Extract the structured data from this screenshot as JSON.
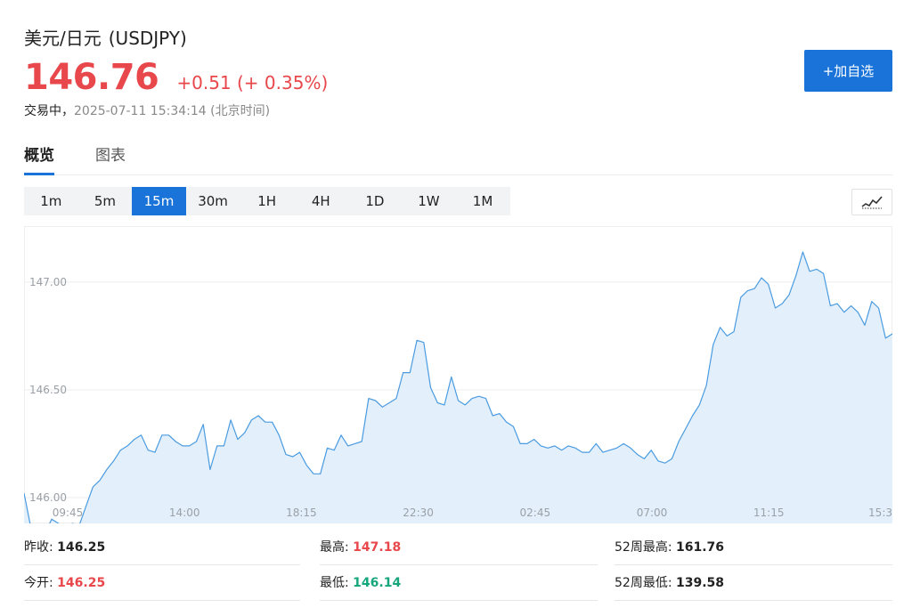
{
  "header": {
    "name": "美元/日元",
    "symbol": "(USDJPY)",
    "price": "146.76",
    "change": "+0.51 (+ 0.35%)",
    "status": "交易中，",
    "timestamp": "2025-07-11 15:34:14 (北京时间)",
    "watch_button": "+加自选"
  },
  "tabs": [
    {
      "label": "概览",
      "active": true
    },
    {
      "label": "图表",
      "active": false
    }
  ],
  "periods": [
    {
      "label": "1m",
      "active": false
    },
    {
      "label": "5m",
      "active": false
    },
    {
      "label": "15m",
      "active": true
    },
    {
      "label": "30m",
      "active": false
    },
    {
      "label": "1H",
      "active": false
    },
    {
      "label": "4H",
      "active": false
    },
    {
      "label": "1D",
      "active": false
    },
    {
      "label": "1W",
      "active": false
    },
    {
      "label": "1M",
      "active": false
    }
  ],
  "chart_type_icon": "line-chart-icon",
  "colors": {
    "accent": "#1a73d9",
    "up": "#e8474b",
    "down": "#16a67c",
    "line": "#4a9be0",
    "fill": "#e3f0fc"
  },
  "chart_data": {
    "type": "area",
    "title": "",
    "xlabel": "",
    "ylabel": "",
    "ylim": [
      145.88,
      147.26
    ],
    "yticks": [
      "146.00",
      "146.50",
      "147.00"
    ],
    "xticks": [
      "09:45",
      "14:00",
      "18:15",
      "22:30",
      "02:45",
      "07:00",
      "11:15",
      "15:3"
    ],
    "grid": true,
    "series": [
      {
        "values": [
          146.02,
          145.86,
          145.86,
          145.83,
          145.9,
          145.88,
          145.8,
          145.88,
          145.87,
          145.96,
          146.05,
          146.08,
          146.13,
          146.17,
          146.22,
          146.24,
          146.27,
          146.29,
          146.22,
          146.21,
          146.29,
          146.29,
          146.26,
          146.24,
          146.24,
          146.26,
          146.34,
          146.13,
          146.24,
          146.24,
          146.36,
          146.27,
          146.3,
          146.36,
          146.38,
          146.35,
          146.35,
          146.29,
          146.2,
          146.19,
          146.21,
          146.15,
          146.11,
          146.11,
          146.23,
          146.22,
          146.29,
          146.24,
          146.25,
          146.26,
          146.46,
          146.45,
          146.42,
          146.44,
          146.46,
          146.58,
          146.58,
          146.73,
          146.72,
          146.51,
          146.44,
          146.43,
          146.56,
          146.45,
          146.43,
          146.46,
          146.47,
          146.46,
          146.38,
          146.39,
          146.35,
          146.33,
          146.25,
          146.25,
          146.27,
          146.24,
          146.23,
          146.24,
          146.22,
          146.24,
          146.23,
          146.21,
          146.21,
          146.25,
          146.21,
          146.22,
          146.23,
          146.25,
          146.23,
          146.2,
          146.18,
          146.22,
          146.17,
          146.16,
          146.18,
          146.26,
          146.32,
          146.38,
          146.43,
          146.52,
          146.71,
          146.79,
          146.75,
          146.77,
          146.93,
          146.96,
          146.97,
          147.02,
          146.99,
          146.88,
          146.9,
          146.94,
          147.03,
          147.14,
          147.05,
          147.06,
          147.04,
          146.89,
          146.9,
          146.86,
          146.89,
          146.86,
          146.8,
          146.91,
          146.88,
          146.74,
          146.76
        ]
      }
    ]
  },
  "stats": [
    {
      "label": "昨收:",
      "value": "146.25",
      "tone": "neutral"
    },
    {
      "label": "最高:",
      "value": "147.18",
      "tone": "up"
    },
    {
      "label": "52周最高:",
      "value": "161.76",
      "tone": "neutral"
    },
    {
      "label": "今开:",
      "value": "146.25",
      "tone": "up"
    },
    {
      "label": "最低:",
      "value": "146.14",
      "tone": "down"
    },
    {
      "label": "52周最低:",
      "value": "139.58",
      "tone": "neutral"
    }
  ]
}
